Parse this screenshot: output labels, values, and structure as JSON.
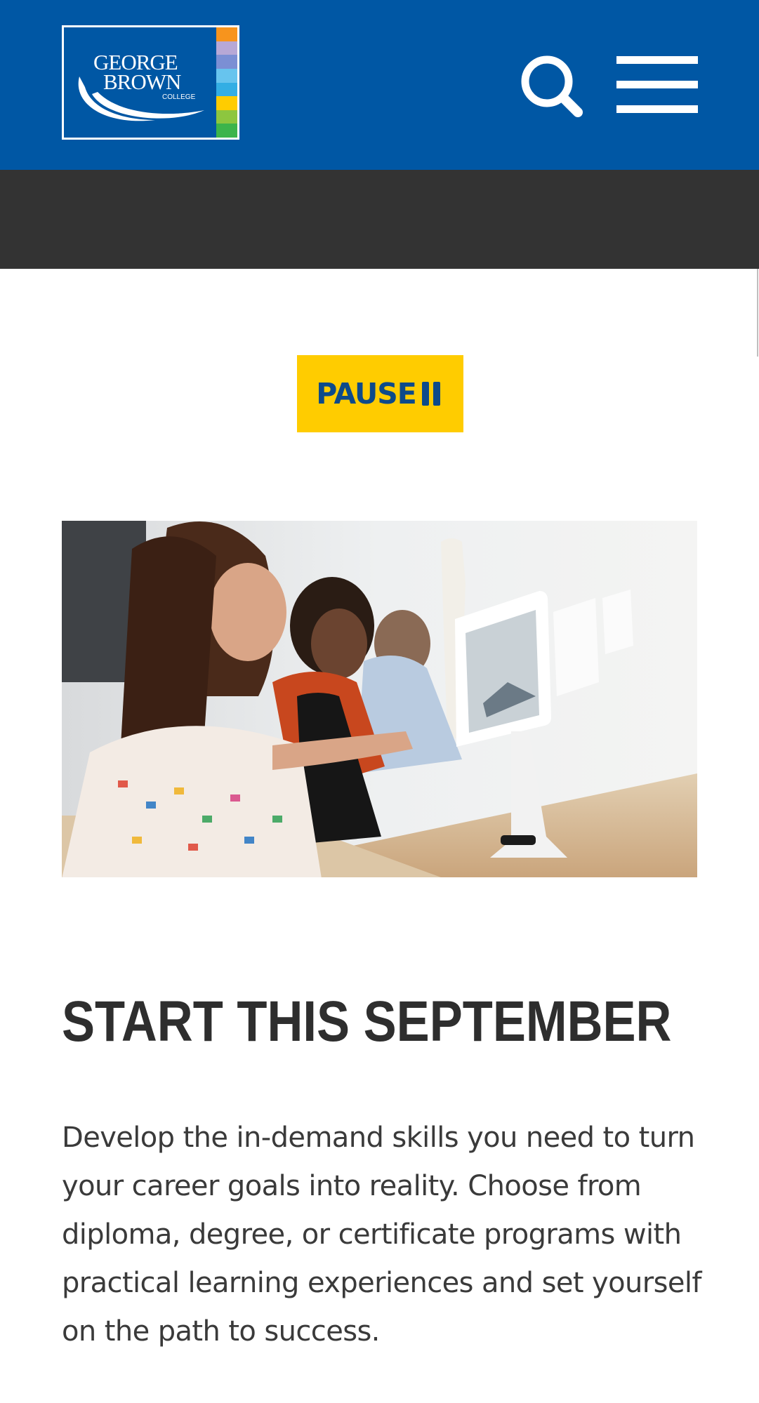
{
  "header": {
    "logo": {
      "lines": [
        "GEORGE",
        "BROWN",
        "COLLEGE"
      ],
      "stripe_colors": [
        "#f7941d",
        "#b7a8d6",
        "#7b8fd4",
        "#67c4ee",
        "#33aee4",
        "#ffcc00",
        "#8dc63f",
        "#3cb44b"
      ]
    },
    "search_icon": "search-icon",
    "menu_icon": "hamburger-menu-icon"
  },
  "controls": {
    "pause_label": "PAUSE",
    "pause_icon": "pause-icon"
  },
  "hero": {
    "image_description_icon": "students-using-tablets-photo"
  },
  "content": {
    "headline": "START THIS SEPTEMBER",
    "body": "Develop the in-demand skills you need to turn your career goals into reality. Choose from diploma, degree, or certificate programs with practical learning experiences and set yourself on the path to success."
  },
  "colors": {
    "header_bg": "#0057a4",
    "band_bg": "#333333",
    "pause_bg": "#ffcc00",
    "pause_text": "#0d4a8a",
    "heading_text": "#2e2e2e"
  }
}
